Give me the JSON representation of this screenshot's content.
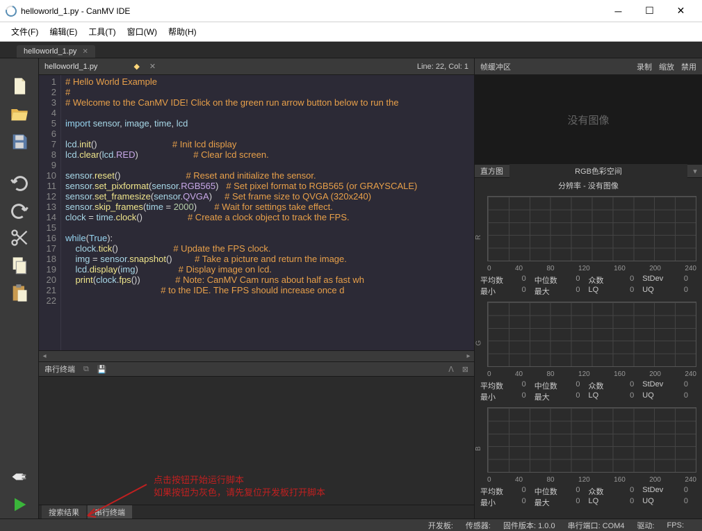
{
  "window": {
    "title": "helloworld_1.py - CanMV IDE"
  },
  "menu": {
    "file": "文件(F)",
    "edit": "编辑(E)",
    "tools": "工具(T)",
    "window": "窗口(W)",
    "help": "帮助(H)"
  },
  "tab": {
    "name": "helloworld_1.py"
  },
  "editor": {
    "filename": "helloworld_1.py",
    "cursor": "Line: 22, Col: 1",
    "lines": [
      {
        "n": "1",
        "html": "<span class='c-cmt'># Hello World Example</span>"
      },
      {
        "n": "2",
        "html": "<span class='c-cmt'>#</span>"
      },
      {
        "n": "3",
        "html": "<span class='c-cmt'># Welcome to the CanMV IDE! Click on the green run arrow button below to run the</span>"
      },
      {
        "n": "4",
        "html": ""
      },
      {
        "n": "5",
        "html": "<span class='c-kw'>import</span> <span class='c-id'>sensor</span><span class='c-p'>,</span> <span class='c-id'>image</span><span class='c-p'>,</span> <span class='c-id'>time</span><span class='c-p'>,</span> <span class='c-id'>lcd</span>"
      },
      {
        "n": "6",
        "html": ""
      },
      {
        "n": "7",
        "html": "<span class='c-id'>lcd</span><span class='c-p'>.</span><span class='c-fn'>init</span><span class='c-p'>()</span>                              <span class='c-cmt'># Init lcd display</span>"
      },
      {
        "n": "8",
        "html": "<span class='c-id'>lcd</span><span class='c-p'>.</span><span class='c-fn'>clear</span><span class='c-p'>(</span><span class='c-id'>lcd</span><span class='c-p'>.</span><span class='c-attr'>RED</span><span class='c-p'>)</span>                      <span class='c-cmt'># Clear lcd screen.</span>"
      },
      {
        "n": "9",
        "html": ""
      },
      {
        "n": "10",
        "html": "<span class='c-id'>sensor</span><span class='c-p'>.</span><span class='c-fn'>reset</span><span class='c-p'>()</span>                          <span class='c-cmt'># Reset and initialize the sensor.</span>"
      },
      {
        "n": "11",
        "html": "<span class='c-id'>sensor</span><span class='c-p'>.</span><span class='c-fn'>set_pixformat</span><span class='c-p'>(</span><span class='c-id'>sensor</span><span class='c-p'>.</span><span class='c-attr'>RGB565</span><span class='c-p'>)</span>   <span class='c-cmt'># Set pixel format to RGB565 (or GRAYSCALE)</span>"
      },
      {
        "n": "12",
        "html": "<span class='c-id'>sensor</span><span class='c-p'>.</span><span class='c-fn'>set_framesize</span><span class='c-p'>(</span><span class='c-id'>sensor</span><span class='c-p'>.</span><span class='c-attr'>QVGA</span><span class='c-p'>)</span>     <span class='c-cmt'># Set frame size to QVGA (320x240)</span>"
      },
      {
        "n": "13",
        "html": "<span class='c-id'>sensor</span><span class='c-p'>.</span><span class='c-fn'>skip_frames</span><span class='c-p'>(</span><span class='c-id'>time</span> <span class='c-p'>=</span> <span class='c-n'>2000</span><span class='c-p'>)</span>       <span class='c-cmt'># Wait for settings take effect.</span>"
      },
      {
        "n": "14",
        "html": "<span class='c-id'>clock</span> <span class='c-p'>=</span> <span class='c-id'>time</span><span class='c-p'>.</span><span class='c-fn'>clock</span><span class='c-p'>()</span>                  <span class='c-cmt'># Create a clock object to track the FPS.</span>"
      },
      {
        "n": "15",
        "html": ""
      },
      {
        "n": "16",
        "html": "<span class='c-kw'>while</span><span class='c-p'>(</span><span class='c-kw'>True</span><span class='c-p'>):</span>",
        "fold": "v"
      },
      {
        "n": "17",
        "html": "    <span class='c-id'>clock</span><span class='c-p'>.</span><span class='c-fn'>tick</span><span class='c-p'>()</span>                      <span class='c-cmt'># Update the FPS clock.</span>"
      },
      {
        "n": "18",
        "html": "    <span class='c-id'>img</span> <span class='c-p'>=</span> <span class='c-id'>sensor</span><span class='c-p'>.</span><span class='c-fn'>snapshot</span><span class='c-p'>()</span>         <span class='c-cmt'># Take a picture and return the image.</span>"
      },
      {
        "n": "19",
        "html": "    <span class='c-id'>lcd</span><span class='c-p'>.</span><span class='c-fn'>display</span><span class='c-p'>(</span><span class='c-id'>img</span><span class='c-p'>)</span>                <span class='c-cmt'># Display image on lcd.</span>"
      },
      {
        "n": "20",
        "html": "    <span class='c-fn'>print</span><span class='c-p'>(</span><span class='c-id'>clock</span><span class='c-p'>.</span><span class='c-fn'>fps</span><span class='c-p'>())</span>              <span class='c-cmt'># Note: CanMV Cam runs about half as fast wh</span>",
        "fold": "v"
      },
      {
        "n": "21",
        "html": "                                      <span class='c-cmt'># to the IDE. The FPS should increase once d</span>"
      },
      {
        "n": "22",
        "html": ""
      }
    ]
  },
  "terminal": {
    "title": "串行终端"
  },
  "annot": {
    "l1": "点击按钮开始运行脚本",
    "l2": "如果按钮为灰色，请先复位开发板打开脚本"
  },
  "termtabs": {
    "search": "搜索结果",
    "serial": "串行终端"
  },
  "right": {
    "frame_buffer": "帧缓冲区",
    "record": "录制",
    "zoom": "缩放",
    "disable": "禁用",
    "no_image": "没有图像",
    "histogram": "直方图",
    "colorspace": "RGB色彩空间",
    "res_title": "分辨率 - 没有图像",
    "xticks": [
      "0",
      "40",
      "80",
      "120",
      "160",
      "200",
      "240"
    ],
    "channels": [
      "R",
      "G",
      "B"
    ],
    "stats": {
      "mean": "平均数",
      "median": "中位数",
      "mode": "众数",
      "stdev": "StDev",
      "min": "最小",
      "max": "最大",
      "lq": "LQ",
      "uq": "UQ",
      "v": "0"
    }
  },
  "status": {
    "board": "开发板:",
    "sensor": "传感器:",
    "fw": "固件版本:",
    "fwv": "1.0.0",
    "port": "串行端口:",
    "portv": "COM4",
    "drive": "驱动:",
    "fps": "FPS:"
  }
}
